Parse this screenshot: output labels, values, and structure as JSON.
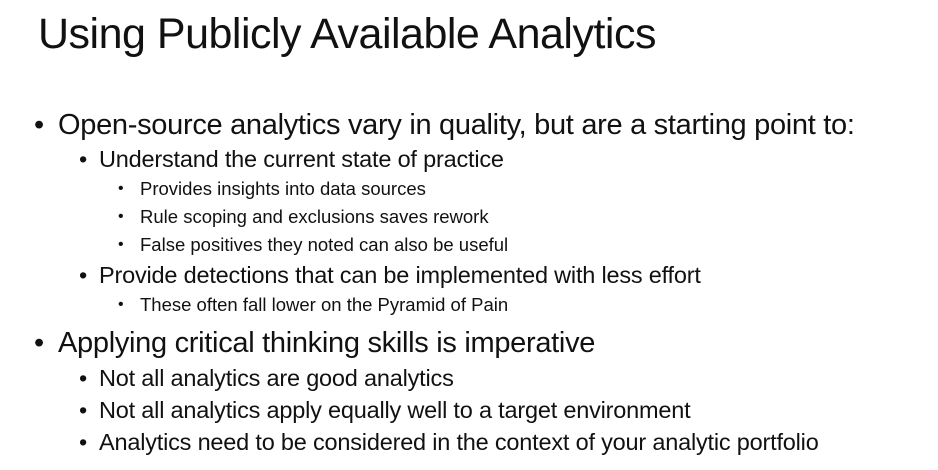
{
  "slide": {
    "title": "Using Publicly Available Analytics",
    "bullet_glyph": "•",
    "items": [
      {
        "level": 1,
        "text": "Open-source analytics vary in quality, but are a starting point to:"
      },
      {
        "level": 2,
        "text": "Understand the current state of practice"
      },
      {
        "level": 3,
        "text": "Provides insights into data sources"
      },
      {
        "level": 3,
        "text": "Rule scoping and exclusions saves rework"
      },
      {
        "level": 3,
        "text": "False positives they noted can also be useful"
      },
      {
        "level": 2,
        "text": "Provide detections that can be implemented with less effort"
      },
      {
        "level": 3,
        "text": "These often fall lower on the Pyramid of Pain"
      },
      {
        "level": 1,
        "text": "Applying critical thinking skills is imperative"
      },
      {
        "level": 2,
        "text": "Not all analytics are good analytics"
      },
      {
        "level": 2,
        "text": "Not all analytics apply equally well to a target environment"
      },
      {
        "level": 2,
        "text": "Analytics need to be considered in the context of your analytic portfolio"
      }
    ]
  }
}
